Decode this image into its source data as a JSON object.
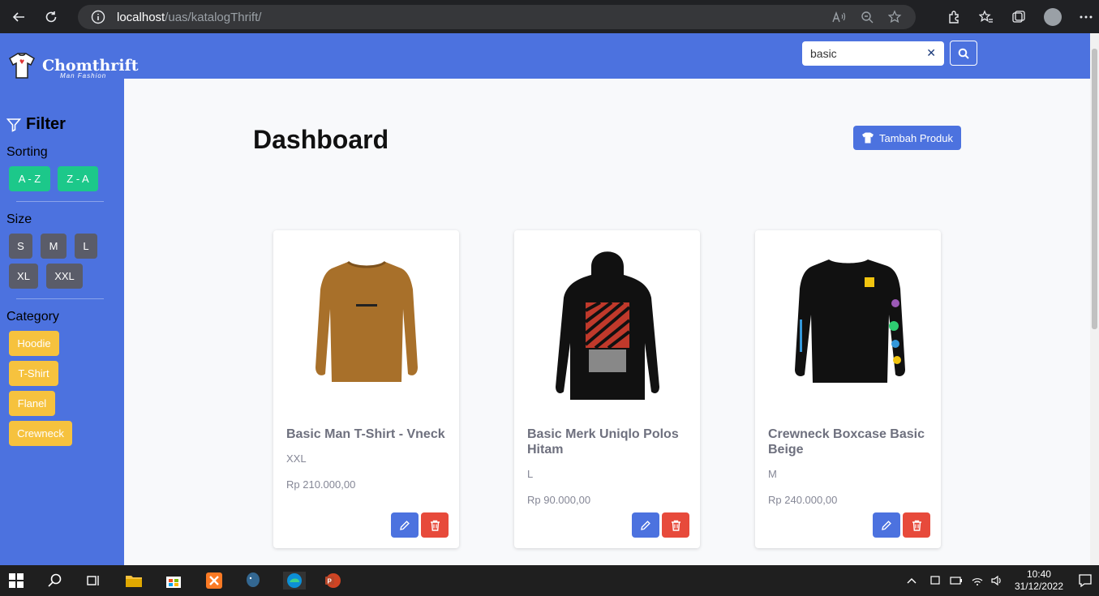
{
  "browser": {
    "url_host": "localhost",
    "url_path": "/uas/katalogThrift/"
  },
  "brand": {
    "name": "Chomthrift",
    "tagline": "Man Fashion"
  },
  "sidebar": {
    "filter_title": "Filter",
    "sorting_label": "Sorting",
    "sorting": [
      "A - Z",
      "Z - A"
    ],
    "size_label": "Size",
    "sizes": [
      "S",
      "M",
      "L",
      "XL",
      "XXL"
    ],
    "category_label": "Category",
    "categories": [
      "Hoodie",
      "T-Shirt",
      "Flanel",
      "Crewneck"
    ]
  },
  "search": {
    "value": "basic"
  },
  "main": {
    "title": "Dashboard",
    "add_button": "Tambah Produk"
  },
  "products": [
    {
      "name": "Basic Man T-Shirt - Vneck",
      "size": "XXL",
      "price": "Rp 210.000,00",
      "color": "#a8702a"
    },
    {
      "name": "Basic Merk Uniqlo Polos Hitam",
      "size": "L",
      "price": "Rp 90.000,00",
      "color": "#111111"
    },
    {
      "name": "Crewneck Boxcase Basic Beige",
      "size": "M",
      "price": "Rp 240.000,00",
      "color": "#111111"
    }
  ],
  "taskbar": {
    "time": "10:40",
    "date": "31/12/2022"
  },
  "colors": {
    "primary": "#4c72df",
    "success": "#1cc88a",
    "secondary": "#5a5c69",
    "warning": "#f6c23e",
    "danger": "#e74a3b"
  }
}
